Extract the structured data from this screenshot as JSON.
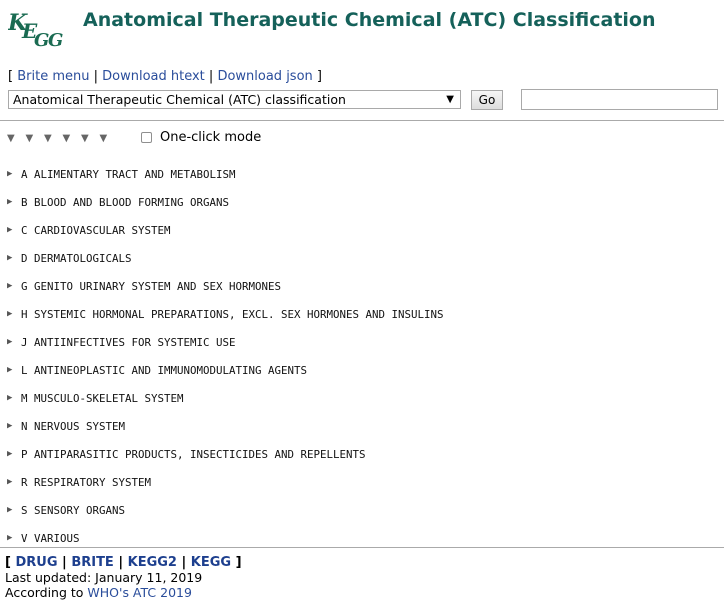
{
  "header": {
    "logo_text": "KEGG",
    "title": "Anatomical Therapeutic Chemical (ATC) Classification"
  },
  "linkbar": {
    "open_bracket": "[ ",
    "brite_menu": "Brite menu",
    "sep1": " | ",
    "download_htext": "Download htext",
    "sep2": " | ",
    "download_json": "Download json",
    "close_bracket": " ]"
  },
  "selector": {
    "selected": "Anatomical Therapeutic Chemical (ATC) classification",
    "go_label": "Go",
    "search_value": ""
  },
  "levels": {
    "level_count": 6,
    "one_click_label": "One-click mode",
    "one_click_checked": false
  },
  "tree": [
    {
      "code": "A",
      "label": "ALIMENTARY TRACT AND METABOLISM"
    },
    {
      "code": "B",
      "label": "BLOOD AND BLOOD FORMING ORGANS"
    },
    {
      "code": "C",
      "label": "CARDIOVASCULAR SYSTEM"
    },
    {
      "code": "D",
      "label": "DERMATOLOGICALS"
    },
    {
      "code": "G",
      "label": "GENITO URINARY SYSTEM AND SEX HORMONES"
    },
    {
      "code": "H",
      "label": "SYSTEMIC HORMONAL PREPARATIONS, EXCL. SEX HORMONES AND INSULINS"
    },
    {
      "code": "J",
      "label": "ANTIINFECTIVES FOR SYSTEMIC USE"
    },
    {
      "code": "L",
      "label": "ANTINEOPLASTIC AND IMMUNOMODULATING AGENTS"
    },
    {
      "code": "M",
      "label": "MUSCULO-SKELETAL SYSTEM"
    },
    {
      "code": "N",
      "label": "NERVOUS SYSTEM"
    },
    {
      "code": "P",
      "label": "ANTIPARASITIC PRODUCTS, INSECTICIDES AND REPELLENTS"
    },
    {
      "code": "R",
      "label": "RESPIRATORY SYSTEM"
    },
    {
      "code": "S",
      "label": "SENSORY ORGANS"
    },
    {
      "code": "V",
      "label": "VARIOUS"
    }
  ],
  "footer": {
    "open_bracket": "[ ",
    "drug": "DRUG",
    "sep1": " | ",
    "brite": "BRITE",
    "sep2": " | ",
    "kegg2": "KEGG2",
    "sep3": " | ",
    "kegg": "KEGG",
    "close_bracket": " ]",
    "last_updated": "Last updated: January 11, 2019",
    "according_prefix": "According to ",
    "according_link": "WHO's ATC 2019"
  },
  "colors": {
    "title": "#15615a",
    "link": "#2a4d9b",
    "logo": "#1a6b52"
  }
}
